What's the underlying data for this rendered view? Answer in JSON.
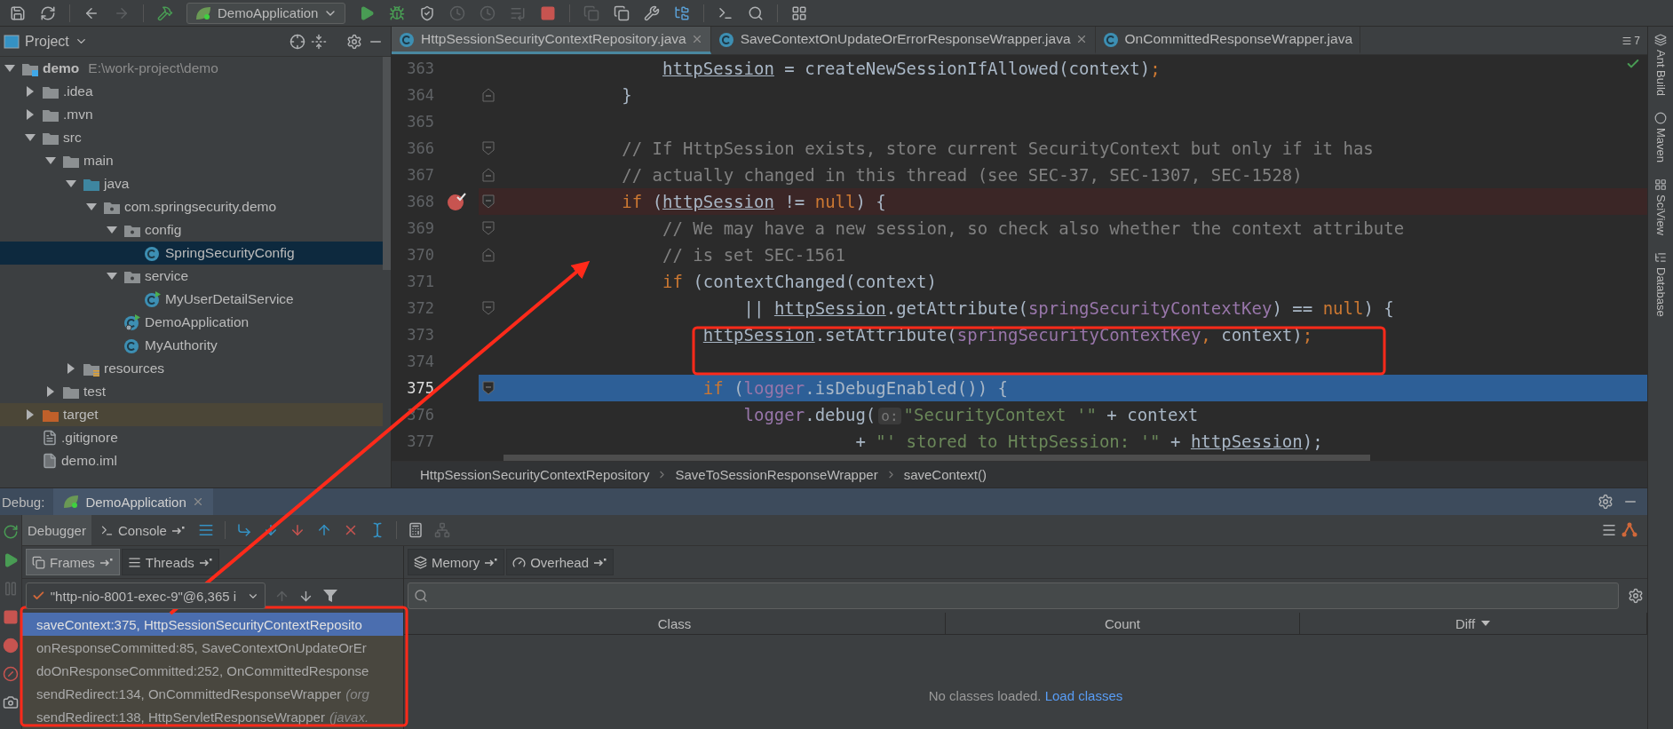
{
  "toolbar": {
    "items": [
      {
        "kind": "save",
        "disabled": false
      },
      {
        "kind": "sync",
        "disabled": false
      },
      {
        "kind": "separator"
      },
      {
        "kind": "back",
        "disabled": false
      },
      {
        "kind": "forward",
        "disabled": true
      },
      {
        "kind": "separator"
      },
      {
        "kind": "build",
        "disabled": false
      },
      {
        "kind": "run-config",
        "label": "DemoApplication"
      },
      {
        "kind": "run",
        "disabled": false
      },
      {
        "kind": "debug",
        "disabled": false
      },
      {
        "kind": "coverage",
        "disabled": false
      },
      {
        "kind": "profile",
        "disabled": true
      },
      {
        "kind": "profile",
        "disabled": true
      },
      {
        "kind": "step-list",
        "disabled": true
      },
      {
        "kind": "stop",
        "disabled": false
      },
      {
        "kind": "separator"
      },
      {
        "kind": "copy",
        "disabled": true
      },
      {
        "kind": "copy",
        "disabled": false
      },
      {
        "kind": "wrench",
        "disabled": false
      },
      {
        "kind": "structure",
        "disabled": false
      },
      {
        "kind": "separator"
      },
      {
        "kind": "terminal",
        "disabled": false
      },
      {
        "kind": "search",
        "disabled": false
      },
      {
        "kind": "separator"
      },
      {
        "kind": "layout",
        "disabled": false
      }
    ]
  },
  "project": {
    "title": "Project",
    "tree": [
      {
        "name": "demo",
        "path": "E:\\work-project\\demo",
        "kind": "module",
        "expanded": true,
        "selected": false,
        "children": [
          {
            "name": ".idea",
            "kind": "folder",
            "expanded": false,
            "selected": false
          },
          {
            "name": ".mvn",
            "kind": "folder",
            "expanded": false,
            "selected": false
          },
          {
            "name": "src",
            "kind": "folder",
            "expanded": true,
            "selected": false,
            "children": [
              {
                "name": "main",
                "kind": "folder",
                "expanded": true,
                "selected": false,
                "children": [
                  {
                    "name": "java",
                    "kind": "source-folder",
                    "expanded": true,
                    "selected": false,
                    "children": [
                      {
                        "name": "com.springsecurity.demo",
                        "kind": "package",
                        "expanded": true,
                        "selected": false,
                        "children": [
                          {
                            "name": "config",
                            "kind": "package",
                            "expanded": true,
                            "selected": false,
                            "children": [
                              {
                                "name": "SpringSecurityConfig",
                                "kind": "class",
                                "selected": true
                              }
                            ]
                          },
                          {
                            "name": "service",
                            "kind": "package",
                            "expanded": true,
                            "selected": false,
                            "children": [
                              {
                                "name": "MyUserDetailService",
                                "kind": "spring-class",
                                "selected": false
                              }
                            ]
                          },
                          {
                            "name": "DemoApplication",
                            "kind": "spring-app",
                            "selected": false
                          },
                          {
                            "name": "MyAuthority",
                            "kind": "class",
                            "selected": false
                          }
                        ]
                      }
                    ]
                  },
                  {
                    "name": "resources",
                    "kind": "resources-folder",
                    "expanded": false,
                    "selected": false
                  }
                ]
              },
              {
                "name": "test",
                "kind": "folder",
                "expanded": false,
                "selected": false
              }
            ]
          },
          {
            "name": "target",
            "kind": "excluded-folder",
            "expanded": false,
            "selected": false
          },
          {
            "name": ".gitignore",
            "kind": "file",
            "selected": false
          },
          {
            "name": "demo.iml",
            "kind": "module-file",
            "selected": false
          }
        ]
      }
    ]
  },
  "editor": {
    "tabs": [
      {
        "label": "HttpSessionSecurityContextRepository.java",
        "selected": true,
        "closable": true
      },
      {
        "label": "SaveContextOnUpdateOrErrorResponseWrapper.java",
        "selected": false,
        "closable": true
      },
      {
        "label": "OnCommittedResponseWrapper.java",
        "selected": false,
        "closable": false
      }
    ],
    "tab_overflow": "7",
    "lines": [
      {
        "number": "363",
        "breakpoint": false,
        "current": false,
        "fold_start": false,
        "fold_end": false,
        "code": [
          {
            "kind": "var",
            "text": "                httpSession"
          },
          {
            "kind": "plain",
            "text": " = createNewSessionIfAllowed(context)"
          },
          {
            "kind": "semi",
            "text": ";"
          }
        ]
      },
      {
        "number": "364",
        "breakpoint": false,
        "current": false,
        "fold_start": false,
        "fold_end": true,
        "code": [
          {
            "kind": "plain",
            "text": "            }"
          }
        ]
      },
      {
        "number": "365",
        "breakpoint": false,
        "current": false,
        "fold_start": false,
        "fold_end": false
      },
      {
        "number": "366",
        "breakpoint": false,
        "current": false,
        "fold_start": true,
        "fold_end": false,
        "code": [
          {
            "kind": "comment",
            "text": "            // If HttpSession exists, store current SecurityContext but only if it has"
          }
        ]
      },
      {
        "number": "367",
        "breakpoint": false,
        "current": false,
        "fold_start": false,
        "fold_end": true,
        "code": [
          {
            "kind": "comment",
            "text": "            // actually changed in this thread (see SEC-37, SEC-1307, SEC-1528)"
          }
        ]
      },
      {
        "number": "368",
        "breakpoint": true,
        "current": false,
        "fold_start": true,
        "fold_end": false,
        "code": [
          {
            "kind": "keyword",
            "text": "            if"
          },
          {
            "kind": "plain",
            "text": " ("
          },
          {
            "kind": "var",
            "text": "httpSession"
          },
          {
            "kind": "plain",
            "text": " != "
          },
          {
            "kind": "keyword",
            "text": "null"
          },
          {
            "kind": "plain",
            "text": ") {"
          }
        ]
      },
      {
        "number": "369",
        "breakpoint": false,
        "current": false,
        "fold_start": true,
        "fold_end": false,
        "code": [
          {
            "kind": "comment",
            "text": "                // We may have a new session, so check also whether the context attribute"
          }
        ]
      },
      {
        "number": "370",
        "breakpoint": false,
        "current": false,
        "fold_start": false,
        "fold_end": true,
        "code": [
          {
            "kind": "comment",
            "text": "                // is set SEC-1561"
          }
        ]
      },
      {
        "number": "371",
        "breakpoint": false,
        "current": false,
        "fold_start": false,
        "fold_end": false,
        "code": [
          {
            "kind": "keyword",
            "text": "                if"
          },
          {
            "kind": "plain",
            "text": " (contextChanged(context)"
          }
        ]
      },
      {
        "number": "372",
        "breakpoint": false,
        "current": false,
        "fold_start": true,
        "fold_end": false,
        "code": [
          {
            "kind": "plain",
            "text": "                        || "
          },
          {
            "kind": "var",
            "text": "httpSession"
          },
          {
            "kind": "plain",
            "text": ".getAttribute("
          },
          {
            "kind": "field",
            "text": "springSecurityContextKey"
          },
          {
            "kind": "plain",
            "text": ") == "
          },
          {
            "kind": "keyword",
            "text": "null"
          },
          {
            "kind": "plain",
            "text": ") {"
          }
        ]
      },
      {
        "number": "373",
        "breakpoint": false,
        "current": false,
        "fold_start": false,
        "fold_end": false,
        "code": [
          {
            "kind": "var",
            "text": "                    httpSession"
          },
          {
            "kind": "plain",
            "text": ".setAttribute("
          },
          {
            "kind": "field",
            "text": "springSecurityContextKey"
          },
          {
            "kind": "semi",
            "text": ","
          },
          {
            "kind": "plain",
            "text": " context)"
          },
          {
            "kind": "semi",
            "text": ";"
          }
        ]
      },
      {
        "number": "374",
        "breakpoint": false,
        "current": false,
        "fold_start": false,
        "fold_end": false
      },
      {
        "number": "375",
        "breakpoint": false,
        "current": true,
        "fold_start": true,
        "fold_end": false,
        "code": [
          {
            "kind": "keyword",
            "text": "                    if"
          },
          {
            "kind": "plain",
            "text": " ("
          },
          {
            "kind": "field",
            "text": "logger"
          },
          {
            "kind": "plain",
            "text": ".isDebugEnabled()) {"
          }
        ]
      },
      {
        "number": "376",
        "breakpoint": false,
        "current": false,
        "fold_start": false,
        "fold_end": false,
        "code": [
          {
            "kind": "field",
            "text": "                        logger"
          },
          {
            "kind": "plain",
            "text": ".debug("
          },
          {
            "kind": "hint",
            "text": "o:"
          },
          {
            "kind": "string",
            "text": "\"SecurityContext '\""
          },
          {
            "kind": "plain",
            "text": " + context"
          }
        ]
      },
      {
        "number": "377",
        "breakpoint": false,
        "current": false,
        "fold_start": false,
        "fold_end": false,
        "code": [
          {
            "kind": "plain",
            "text": "                                   + "
          },
          {
            "kind": "string",
            "text": "\"' stored to HttpSession: '\""
          },
          {
            "kind": "plain",
            "text": " + "
          },
          {
            "kind": "var",
            "text": "httpSession"
          },
          {
            "kind": "plain",
            "text": ");"
          }
        ]
      }
    ],
    "breadcrumbs": [
      "HttpSessionSecurityContextRepository",
      "SaveToSessionResponseWrapper",
      "saveContext()"
    ]
  },
  "right_tools": [
    "Ant Build",
    "Maven",
    "SciView",
    "Database"
  ],
  "debug": {
    "label": "Debug:",
    "session": "DemoApplication",
    "side_icons": [
      {
        "kind": "rerun",
        "disabled": false
      },
      {
        "kind": "resume",
        "disabled": false
      },
      {
        "kind": "pause",
        "disabled": true
      },
      {
        "kind": "stop",
        "disabled": false
      },
      {
        "kind": "breakpoints",
        "disabled": false
      },
      {
        "kind": "mute",
        "disabled": false
      },
      {
        "kind": "camera",
        "disabled": false
      }
    ],
    "tabs": [
      {
        "label": "Debugger",
        "selected": true
      },
      {
        "label": "Console",
        "selected": false
      }
    ],
    "actions": [
      {
        "kind": "execution-point",
        "disabled": false
      },
      {
        "kind": "separator"
      },
      {
        "kind": "step-over",
        "disabled": false
      },
      {
        "kind": "step-into",
        "disabled": false
      },
      {
        "kind": "force-step-into",
        "disabled": false
      },
      {
        "kind": "step-out",
        "disabled": false
      },
      {
        "kind": "drop-frame",
        "disabled": false
      },
      {
        "kind": "run-to-cursor",
        "disabled": false
      },
      {
        "kind": "separator"
      },
      {
        "kind": "evaluate",
        "disabled": false
      },
      {
        "kind": "trace",
        "disabled": true
      }
    ],
    "frames_tabs": [
      {
        "label": "Frames",
        "selected": true
      },
      {
        "label": "Threads",
        "selected": false
      }
    ],
    "thread": "\"http-nio-8001-exec-9\"@6,365 i",
    "frames": [
      {
        "frame": "saveContext:375, HttpSessionSecurityContextReposito",
        "selected": true
      },
      {
        "frame": "onResponseCommitted:85, SaveContextOnUpdateOrEr",
        "selected": false
      },
      {
        "frame": "doOnResponseCommitted:252, OnCommittedResponse",
        "selected": false
      },
      {
        "frame": "sendRedirect:134, OnCommittedResponseWrapper",
        "package": "(org",
        "selected": false
      },
      {
        "frame": "sendRedirect:138, HttpServletResponseWrapper",
        "package": "(javax.",
        "selected": false
      }
    ],
    "memory_tabs": [
      "Memory",
      "Overhead"
    ],
    "columns": [
      {
        "label": "Class",
        "sorted": false
      },
      {
        "label": "Count",
        "sorted": false
      },
      {
        "label": "Diff",
        "sorted": true
      }
    ],
    "empty_message": "No classes loaded.",
    "load_link": "Load classes"
  }
}
